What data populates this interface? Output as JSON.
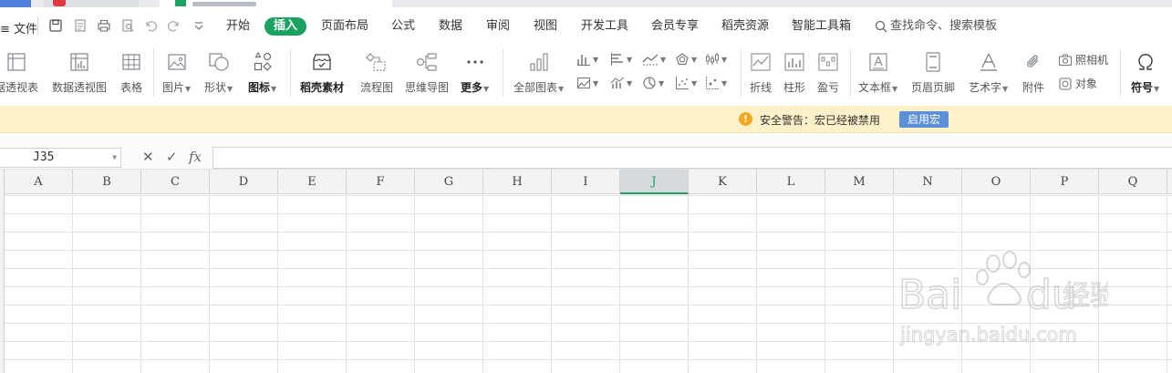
{
  "menu": {
    "file_label": "文件",
    "tabs": [
      "开始",
      "插入",
      "页面布局",
      "公式",
      "数据",
      "审阅",
      "视图",
      "开发工具",
      "会员专享",
      "稻壳资源",
      "智能工具箱"
    ],
    "active_tab": "插入",
    "search_label": "查找命令、搜索模板"
  },
  "ribbon": {
    "pivot_table": "据透视表",
    "pivot_chart": "数据透视图",
    "table": "表格",
    "picture": "图片",
    "shape": "形状",
    "icon": "图标",
    "docer_material": "稻壳素材",
    "flowchart": "流程图",
    "mindmap": "思维导图",
    "more": "更多",
    "all_charts": "全部图表",
    "sparkline_line": "折线",
    "sparkline_column": "柱形",
    "sparkline_winloss": "盈亏",
    "textbox": "文本框",
    "header_footer": "页眉页脚",
    "wordart": "艺术字",
    "attachment": "附件",
    "camera": "照相机",
    "object": "对象",
    "symbol": "符号"
  },
  "warning": {
    "text": "安全警告：宏已经被禁用",
    "button": "启用宏"
  },
  "formula_bar": {
    "name_box": "J35",
    "fx_label": "fx"
  },
  "columns": [
    "A",
    "B",
    "C",
    "D",
    "E",
    "F",
    "G",
    "H",
    "I",
    "J",
    "K",
    "L",
    "M",
    "N",
    "O",
    "P",
    "Q"
  ],
  "selected_column": "J",
  "colors": {
    "accent_green": "#1ba261",
    "warning_bg": "#fdf1c9",
    "warning_button": "#5b8fd6"
  }
}
